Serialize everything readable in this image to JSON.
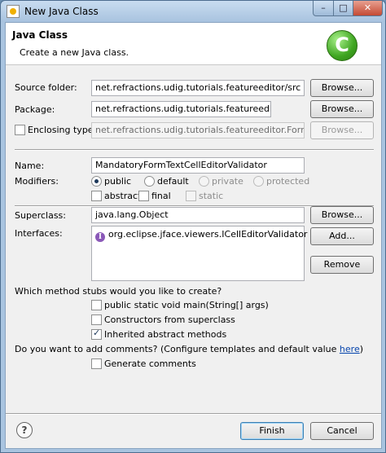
{
  "window": {
    "title": "New Java Class",
    "min_glyph": "–",
    "max_glyph": "□",
    "close_glyph": "✕"
  },
  "header": {
    "title": "Java Class",
    "description": "Create a new Java class.",
    "icon_letter": "C"
  },
  "source_folder": {
    "label": "Source folder:",
    "value": "net.refractions.udig.tutorials.featureeditor/src",
    "button": "Browse..."
  },
  "package": {
    "label": "Package:",
    "value": "net.refractions.udig.tutorials.featureeditor",
    "button": "Browse..."
  },
  "enclosing_type": {
    "label": "Enclosing type:",
    "value": "net.refractions.udig.tutorials.featureeditor.FormCellEditor",
    "button": "Browse...",
    "checked": false
  },
  "name": {
    "label": "Name:",
    "value": "MandatoryFormTextCellEditorValidator"
  },
  "modifiers": {
    "label": "Modifiers:",
    "public": "public",
    "default": "default",
    "private": "private",
    "protected": "protected",
    "abstract": "abstract",
    "final": "final",
    "static": "static"
  },
  "superclass": {
    "label": "Superclass:",
    "value": "java.lang.Object",
    "button": "Browse..."
  },
  "interfaces": {
    "label": "Interfaces:",
    "items": [
      "org.eclipse.jface.viewers.ICellEditorValidator"
    ],
    "icon_letter": "I",
    "add_button": "Add...",
    "remove_button": "Remove"
  },
  "stubs": {
    "question": "Which method stubs would you like to create?",
    "main": "public static void main(String[] args)",
    "constructors": "Constructors from superclass",
    "inherited": "Inherited abstract methods"
  },
  "comments": {
    "question_prefix": "Do you want to add comments? (Configure templates and default value ",
    "link": "here",
    "question_suffix": ")",
    "generate": "Generate comments"
  },
  "footer": {
    "help": "?",
    "finish": "Finish",
    "cancel": "Cancel"
  }
}
